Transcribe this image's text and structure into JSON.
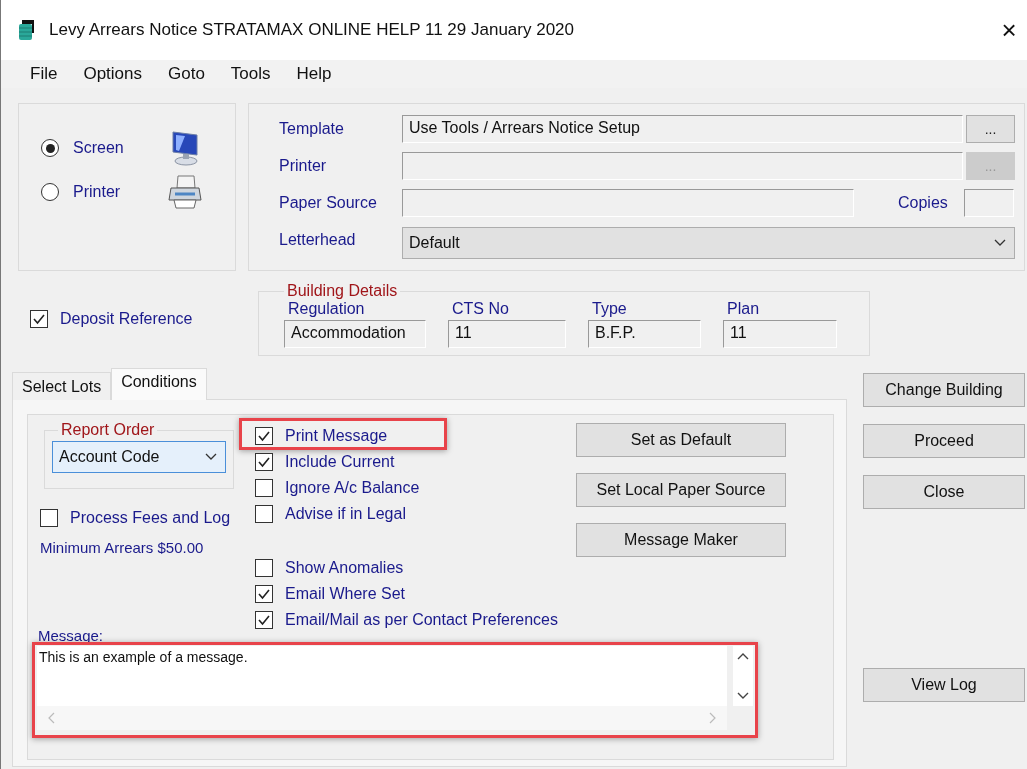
{
  "window": {
    "title": "Levy Arrears Notice STRATAMAX ONLINE HELP 11 29 January 2020",
    "close": "×"
  },
  "menu": [
    "File",
    "Options",
    "Goto",
    "Tools",
    "Help"
  ],
  "output": [
    {
      "label": "Screen",
      "selected": true,
      "kind": "monitor"
    },
    {
      "label": "Printer",
      "selected": false,
      "kind": "printer"
    }
  ],
  "settings": [
    {
      "label": "Template",
      "kind": "browse",
      "value": "Use Tools / Arrears Notice Setup",
      "button": "...",
      "disabled": false
    },
    {
      "label": "Printer",
      "kind": "browse",
      "button": "...",
      "disabled": true
    },
    {
      "label": "Paper Source",
      "kind": "copies",
      "copies_label": "Copies"
    },
    {
      "label": "Letterhead",
      "kind": "dropdown",
      "value": "Default"
    }
  ],
  "deposit_reference": {
    "label": "Deposit Reference",
    "checked": true
  },
  "building_details": {
    "title": "Building Details",
    "columns": [
      {
        "label": "Regulation",
        "value": "Accommodation"
      },
      {
        "label": "CTS No",
        "value": "11"
      },
      {
        "label": "Type",
        "value": "B.F.P."
      },
      {
        "label": "Plan",
        "value": "11"
      }
    ]
  },
  "tabs": [
    {
      "label": "Select Lots",
      "selected": false
    },
    {
      "label": "Conditions",
      "selected": true
    }
  ],
  "conditions": {
    "report_order": {
      "title": "Report Order",
      "value": "Account Code"
    },
    "process_fees": {
      "label": "Process Fees and Log",
      "checked": false
    },
    "minimum_arrears": "Minimum Arrears $50.00",
    "option_groups": [
      [
        {
          "label": "Print Message",
          "checked": true,
          "highlighted": true
        },
        {
          "label": "Include Current",
          "checked": true,
          "highlighted": false
        },
        {
          "label": "Ignore A/c Balance",
          "checked": false,
          "highlighted": false
        },
        {
          "label": "Advise if in Legal",
          "checked": false,
          "highlighted": false
        }
      ],
      [
        {
          "label": "Show Anomalies",
          "checked": false,
          "highlighted": false
        },
        {
          "label": "Email Where Set",
          "checked": true,
          "highlighted": false
        },
        {
          "label": "Email/Mail as per Contact Preferences",
          "checked": true,
          "highlighted": false
        }
      ]
    ],
    "buttons": [
      "Set as Default",
      "Set Local Paper Source",
      "Message Maker"
    ],
    "message": {
      "label": "Message:",
      "value": "This is an example of a message.",
      "highlighted": true
    }
  },
  "side_buttons": [
    "Change Building",
    "Proceed",
    "Close"
  ],
  "view_log": "View Log"
}
